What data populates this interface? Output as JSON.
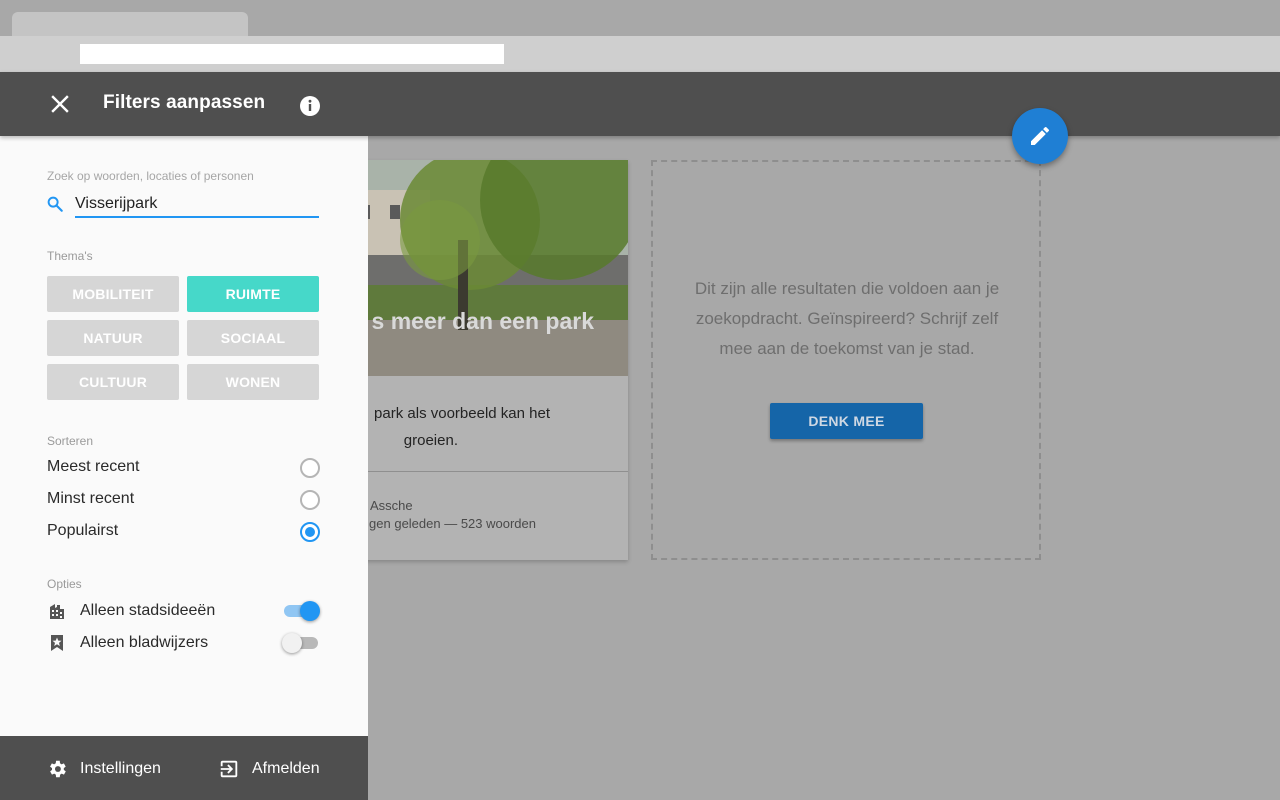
{
  "header": {
    "title": "Filters aanpassen"
  },
  "filters": {
    "search_label": "Zoek op woorden, locaties of personen",
    "search_value": "Visserijpark",
    "themes_label": "Thema's",
    "themes": [
      {
        "label": "MOBILITEIT",
        "active": false
      },
      {
        "label": "RUIMTE",
        "active": true
      },
      {
        "label": "NATUUR",
        "active": false
      },
      {
        "label": "SOCIAAL",
        "active": false
      },
      {
        "label": "CULTUUR",
        "active": false
      },
      {
        "label": "WONEN",
        "active": false
      }
    ],
    "sort_label": "Sorteren",
    "sort_options": [
      {
        "label": "Meest recent",
        "selected": false
      },
      {
        "label": "Minst recent",
        "selected": false
      },
      {
        "label": "Populairst",
        "selected": true
      }
    ],
    "options_label": "Opties",
    "options": [
      {
        "label": "Alleen stadsideeën",
        "icon": "city-icon",
        "on": true
      },
      {
        "label": "Alleen bladwijzers",
        "icon": "bookmark-star-icon",
        "on": false
      }
    ]
  },
  "footer": {
    "settings_label": "Instellingen",
    "logout_label": "Afmelden"
  },
  "card": {
    "image_title": "s meer dan een park",
    "excerpt_line1": "park als voorbeeld kan het",
    "excerpt_line2": "groeien.",
    "meta_line1": "Assche",
    "meta_line2": "gen geleden — 523 woorden"
  },
  "cta": {
    "text": "Dit zijn alle resultaten die voldoen aan je zoekopdracht. Geïnspireerd? Schrijf zelf mee aan de toekomst van je stad.",
    "button_label": "DENK MEE"
  },
  "colors": {
    "accent": "#2196f3",
    "theme_active": "#46d8c9",
    "header": "#4f4f4f"
  }
}
